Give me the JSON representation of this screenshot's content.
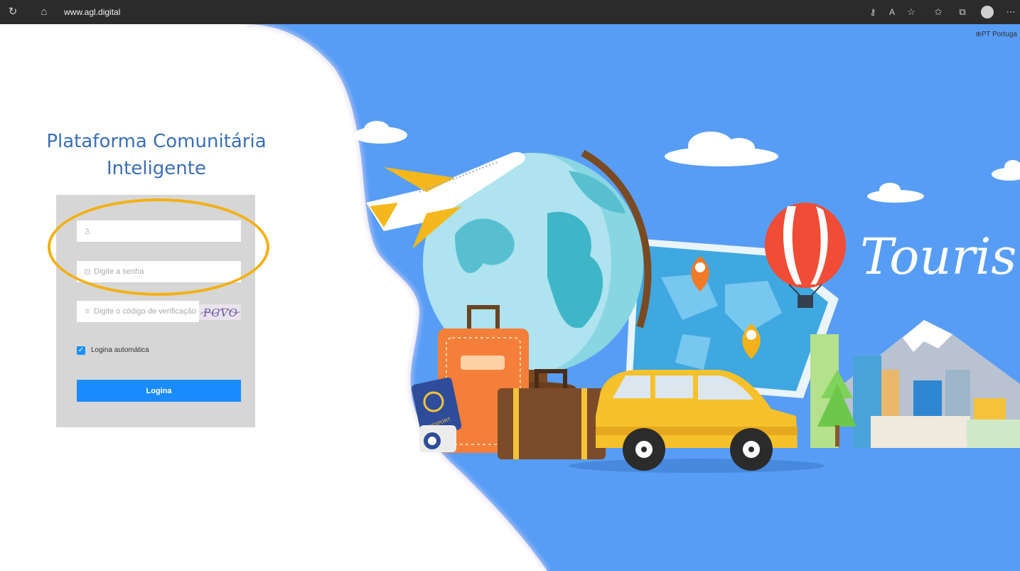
{
  "browser": {
    "url": "www.agl.digital",
    "icons": [
      "refresh-icon",
      "home-icon",
      "key-icon",
      "read-aloud-icon",
      "favorite-add-icon",
      "favorites-icon",
      "collections-icon",
      "profile-avatar",
      "more-icon"
    ]
  },
  "language": "⊕PT Portuga",
  "login": {
    "title_line1": "Plataforma Comunitária",
    "title_line2": "Inteligente",
    "username_placeholder": "",
    "password_placeholder": "Digite a senha",
    "captcha_placeholder": "Digite o código de verificação",
    "captcha_text": "PGVO",
    "auto_login_label": "Logina automática",
    "auto_login_checked": true,
    "submit_label": "Logina"
  },
  "illustration": {
    "script_text": "Touris",
    "passport_text": "PASSPORT"
  },
  "colors": {
    "sky": "#589df5",
    "brand": "#3b6fb6",
    "button": "#1a8cff",
    "highlight": "#f3b012"
  }
}
